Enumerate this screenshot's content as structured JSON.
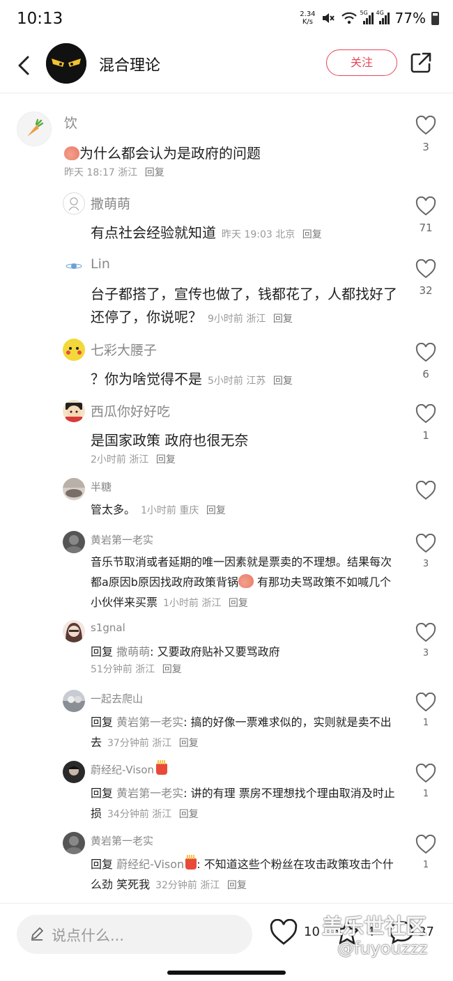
{
  "status": {
    "time": "10:13",
    "net_speed_top": "2.34",
    "net_speed_bottom": "K/s",
    "sig1_label": "5G",
    "sig2_label": "4G",
    "battery": "77%",
    "mute_icon": "mute-icon",
    "wifi_icon": "wifi-icon"
  },
  "header": {
    "title": "混合理论",
    "follow_label": "关注",
    "accent": "#e6455b"
  },
  "comments": [
    {
      "user": "饮",
      "pre_emoji": "peach",
      "text": "为什么都会认为是政府的问题",
      "time": "昨天 18:17",
      "loc": "浙江",
      "reply": "回复",
      "likes": "3"
    },
    {
      "user": "撒萌萌",
      "text": "有点社会经验就知道",
      "time": "昨天 19:03",
      "loc": "北京",
      "reply": "回复",
      "likes": "71"
    },
    {
      "user": "Lin",
      "text": "台子都搭了，宣传也做了，钱都花了，人都找好了还停了，你说呢？",
      "time": "9小时前",
      "loc": "浙江",
      "reply": "回复",
      "likes": "32"
    },
    {
      "user": "七彩大腰子",
      "text": "？你为啥觉得不是",
      "time": "5小时前",
      "loc": "江苏",
      "reply": "回复",
      "likes": "6"
    },
    {
      "user": "西瓜你好好吃",
      "text": "是国家政策 政府也很无奈",
      "time": "2小时前",
      "loc": "浙江",
      "reply": "回复",
      "likes": "1"
    },
    {
      "user": "半糖",
      "text": "管太多。",
      "time": "1小时前",
      "loc": "重庆",
      "reply": "回复",
      "likes": ""
    },
    {
      "user": "黄岩第一老实",
      "text_a": "音乐节取消或者延期的唯一因素就是票卖的不理想。结果每次都a原因b原因找政府政策背锅",
      "text_b": " 有那功夫骂政策不如喊几个小伙伴来买票",
      "time": "1小时前",
      "loc": "浙江",
      "reply": "回复",
      "likes": "3"
    },
    {
      "user": "s1gnal",
      "reply_prefix": "回复",
      "reply_to": "撒萌萌",
      "text": "又要政府贴补又要骂政府",
      "time": "51分钟前",
      "loc": "浙江",
      "reply": "回复",
      "likes": "3"
    },
    {
      "user": "一起去爬山",
      "reply_prefix": "回复",
      "reply_to": "黄岩第一老实",
      "text": "搞的好像一票难求似的，实则就是卖不出去",
      "time": "37分钟前",
      "loc": "浙江",
      "reply": "回复",
      "likes": "1"
    },
    {
      "user": "蔚经纪-Vison",
      "reply_prefix": "回复",
      "reply_to": "黄岩第一老实",
      "text": "讲的有理 票房不理想找个理由取消及时止损",
      "time": "34分钟前",
      "loc": "浙江",
      "reply": "回复",
      "likes": "1"
    },
    {
      "user": "黄岩第一老实",
      "reply_prefix": "回复",
      "reply_to": "蔚经纪-Vison",
      "text": "不知道这些个粉丝在攻击政策攻击个什么劲 笑死我",
      "time": "32分钟前",
      "loc": "浙江",
      "reply": "回复",
      "likes": "1"
    }
  ],
  "bottom": {
    "placeholder": "说点什么...",
    "like_count": "10",
    "fav_count": "4",
    "comment_count": "37",
    "watermark_line1": "盖乐世社区",
    "watermark_line2": "@fuyouzzz"
  }
}
